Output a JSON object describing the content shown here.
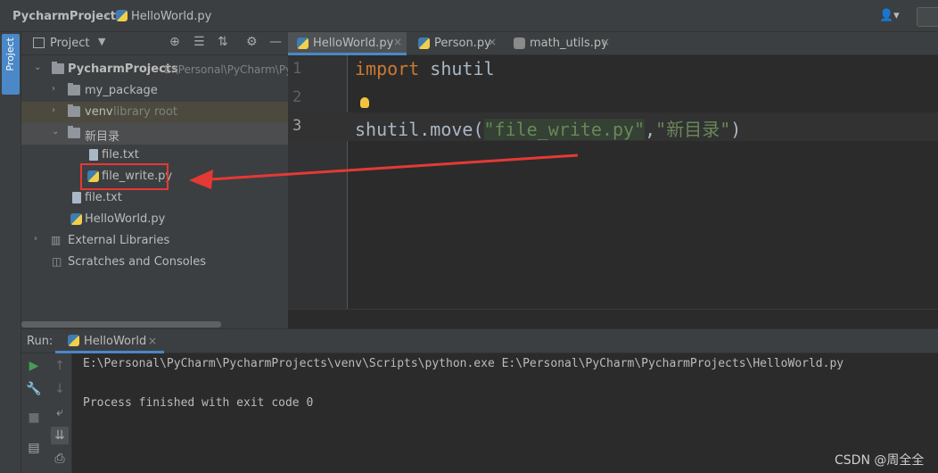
{
  "breadcrumb": {
    "root": "PycharmProjects",
    "file": "HelloWorld.py"
  },
  "project_panel": {
    "view_label": "Project",
    "tree": [
      {
        "label": "PycharmProjects",
        "hint": "E:\\Personal\\PyCharm\\Py",
        "type": "folder",
        "expanded": true
      },
      {
        "label": "my_package",
        "type": "folder",
        "expanded": false
      },
      {
        "label": "venv",
        "hint": "library root",
        "type": "folder",
        "expanded": false
      },
      {
        "label": "新目录",
        "type": "folder",
        "expanded": true
      },
      {
        "label": "file.txt",
        "type": "text-file"
      },
      {
        "label": "file_write.py",
        "type": "python-file",
        "highlighted": true
      },
      {
        "label": "file.txt",
        "type": "text-file"
      },
      {
        "label": "HelloWorld.py",
        "type": "python-file"
      },
      {
        "label": "External Libraries",
        "type": "libraries",
        "expanded": false
      },
      {
        "label": "Scratches and Consoles",
        "type": "scratches"
      }
    ]
  },
  "editor": {
    "tabs": [
      {
        "label": "HelloWorld.py",
        "active": true
      },
      {
        "label": "Person.py",
        "active": false
      },
      {
        "label": "math_utils.py",
        "active": false
      }
    ],
    "line_numbers": [
      "1",
      "2",
      "3"
    ],
    "lines": {
      "l1_kw": "import",
      "l1_rest": " shutil",
      "l3_pre": "shutil.move(",
      "l3_str1": "\"file_write.py\"",
      "l3_comma": ",",
      "l3_str2": "\"新目录\"",
      "l3_post": ")"
    }
  },
  "run_panel": {
    "label": "Run:",
    "tab": "HelloWorld",
    "console": [
      "E:\\Personal\\PyCharm\\PycharmProjects\\venv\\Scripts\\python.exe E:\\Personal\\PyCharm\\PycharmProjects\\HelloWorld.py",
      "Process finished with exit code 0"
    ]
  },
  "side_tab": "Project",
  "watermark": "CSDN @周全全",
  "colors": {
    "accent": "#4a88c7",
    "keyword": "#cc7832",
    "string": "#6a8759",
    "annotation_red": "#e53935"
  }
}
